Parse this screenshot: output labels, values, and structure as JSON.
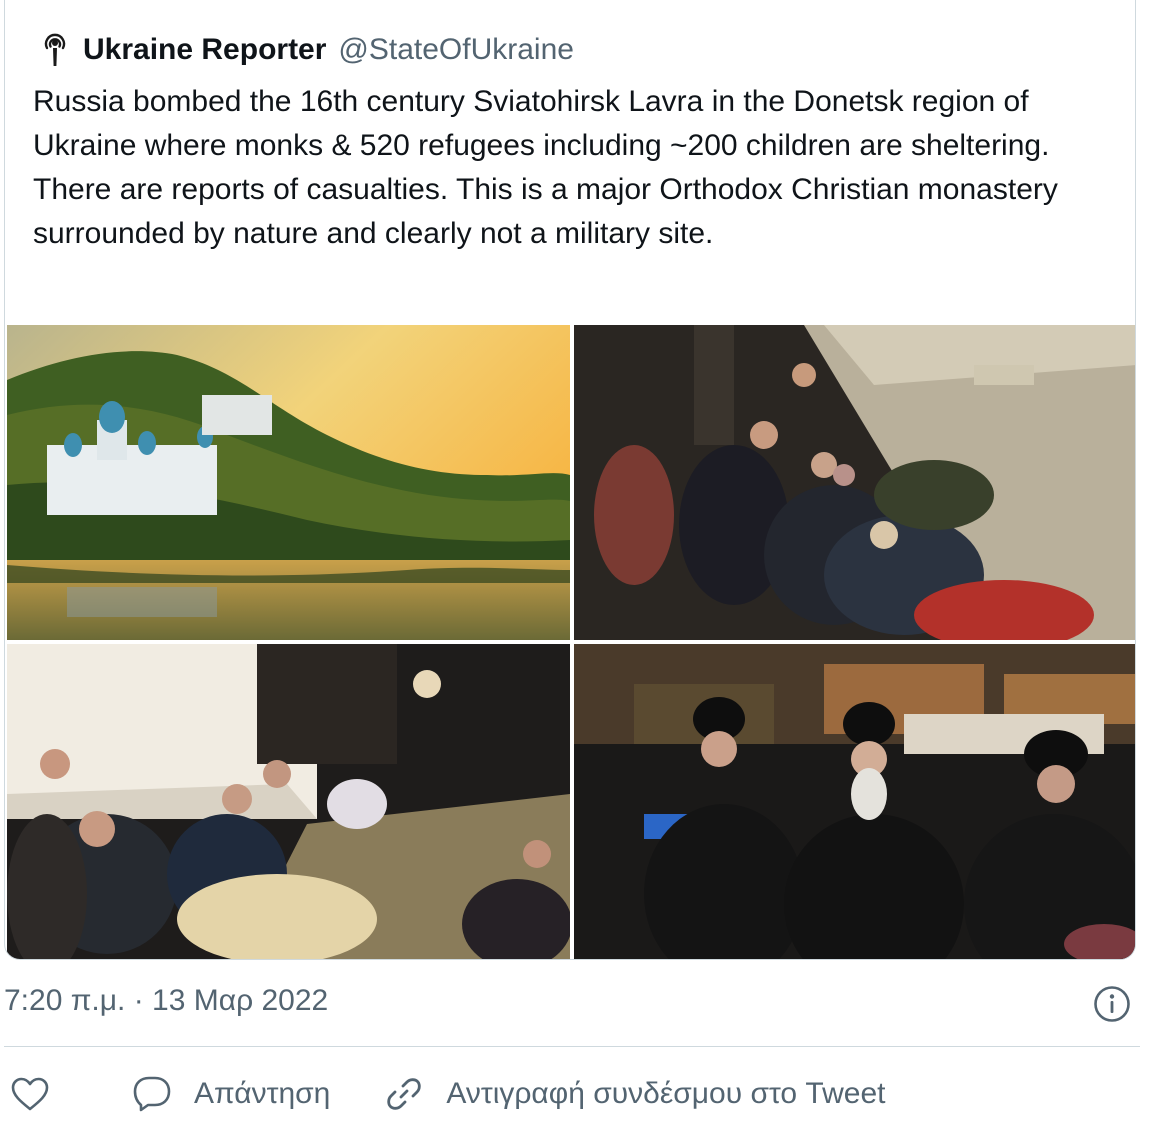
{
  "tweet": {
    "author": {
      "name": "Ukraine Reporter",
      "handle": "@StateOfUkraine",
      "avatar_icon": "podcast-icon"
    },
    "text": "Russia bombed the 16th century Sviatohirsk Lavra in the Donetsk region of Ukraine where monks & 520 refugees including ~200 children are sheltering. There are reports of casualties. This is a major Orthodox Christian monastery surrounded by nature and clearly not a military site.",
    "timestamp": "7:20 π.μ. · 13 Μαρ 2022",
    "actions": {
      "like_icon": "heart-icon",
      "reply_icon": "speech-bubble-icon",
      "reply_label": "Απάντηση",
      "copy_link_icon": "link-icon",
      "copy_link_label": "Αντιγραφή συνδέσμου στο Tweet",
      "info_icon": "info-icon"
    },
    "colors": {
      "text": "#0f1419",
      "secondary": "#536471",
      "border": "#cfd9de"
    }
  }
}
